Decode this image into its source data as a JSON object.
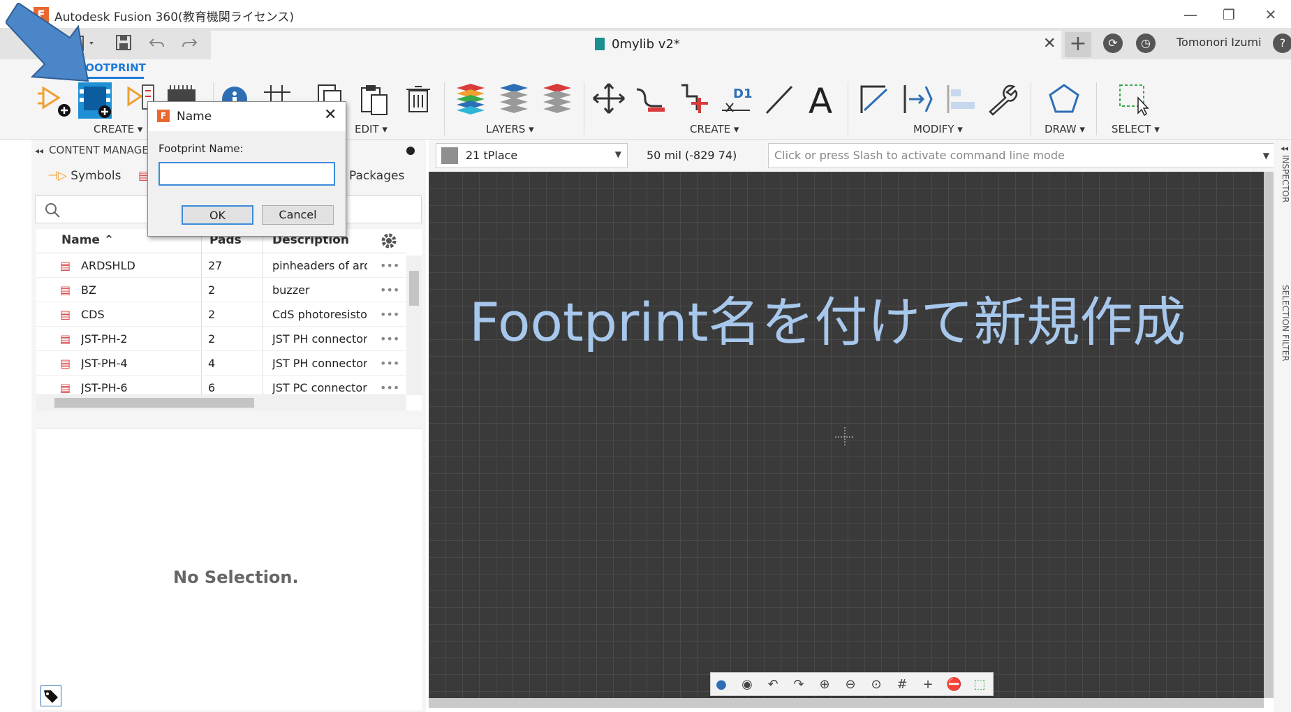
{
  "window": {
    "app_title": "Autodesk Fusion 360(教育機関ライセンス)",
    "logo_letter": "F",
    "minimize": "—",
    "restore": "❐",
    "close": "✕"
  },
  "tabbar": {
    "doc_name": "0mylib v2*",
    "close_glyph": "✕",
    "new_tab_glyph": "+",
    "user_name": "Tomonori Izumi"
  },
  "ribbon": {
    "workspace_tab": "FOOTPRINT",
    "groups": {
      "create_left": "CREATE ▾",
      "edit": "EDIT ▾",
      "layers": "LAYERS ▾",
      "create_right": "CREATE ▾",
      "modify": "MODIFY ▾",
      "draw": "DRAW ▾",
      "select": "SELECT ▾"
    },
    "dimension_label": "D1"
  },
  "content_manager": {
    "title": "CONTENT MANAGER",
    "tabs": {
      "symbols": "Symbols",
      "packages": "Packages"
    },
    "columns": {
      "name": "Name ⌃",
      "pads": "Pads",
      "description": "Description"
    },
    "rows": [
      {
        "name": "ARDSHLD",
        "pads": "27",
        "description": "pinheaders of arduino"
      },
      {
        "name": "BZ",
        "pads": "2",
        "description": "buzzer"
      },
      {
        "name": "CDS",
        "pads": "2",
        "description": "CdS photoresistor"
      },
      {
        "name": "JST-PH-2",
        "pads": "2",
        "description": "JST PH connector"
      },
      {
        "name": "JST-PH-4",
        "pads": "4",
        "description": "JST PH connector"
      },
      {
        "name": "JST-PH-6",
        "pads": "6",
        "description": "JST PC connector"
      }
    ],
    "row_menu": "•••",
    "no_selection": "No Selection."
  },
  "command_bar": {
    "layer": "21 tPlace",
    "grid_readout": "50 mil (-829 74)",
    "command_placeholder": "Click or press Slash to activate command line mode"
  },
  "right_strip": {
    "inspector": "INSPECTOR",
    "selection_filter": "SELECTION FILTER"
  },
  "overlay_caption": "Footprint名を付けて新規作成",
  "dialog": {
    "title": "Name",
    "icon_letter": "F",
    "close_glyph": "✕",
    "label": "Footprint Name:",
    "value": "",
    "ok": "OK",
    "cancel": "Cancel"
  },
  "colors": {
    "accent": "#1e7bd6",
    "canvas": "#3a3a3a",
    "caption": "#a7c8ec",
    "arrow": "#4a86c8"
  }
}
